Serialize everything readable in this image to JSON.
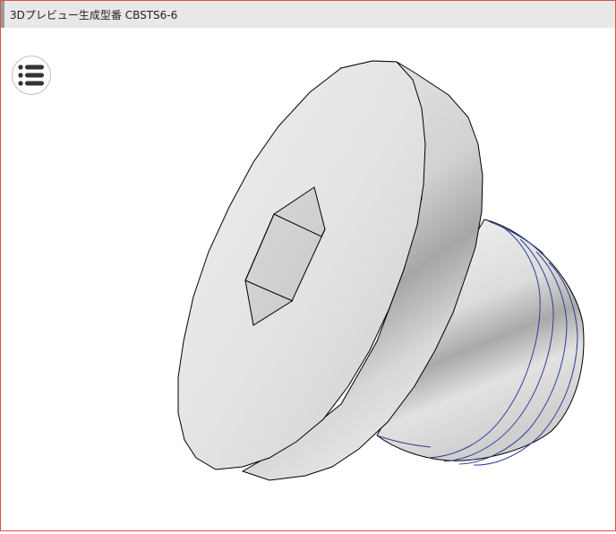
{
  "window": {
    "title": "3Dプレビュー生成型番 CBSTS6-6"
  },
  "toolbar": {
    "menu_icon": "list-menu-icon"
  },
  "preview": {
    "model": "socket-head-screw-3d",
    "colors": {
      "accent_border": "#d9534f",
      "thread_line": "#2f3f9a",
      "edge_line": "#000000",
      "metal_light": "#f2f2f2",
      "metal_dark": "#a8a8a8"
    }
  }
}
